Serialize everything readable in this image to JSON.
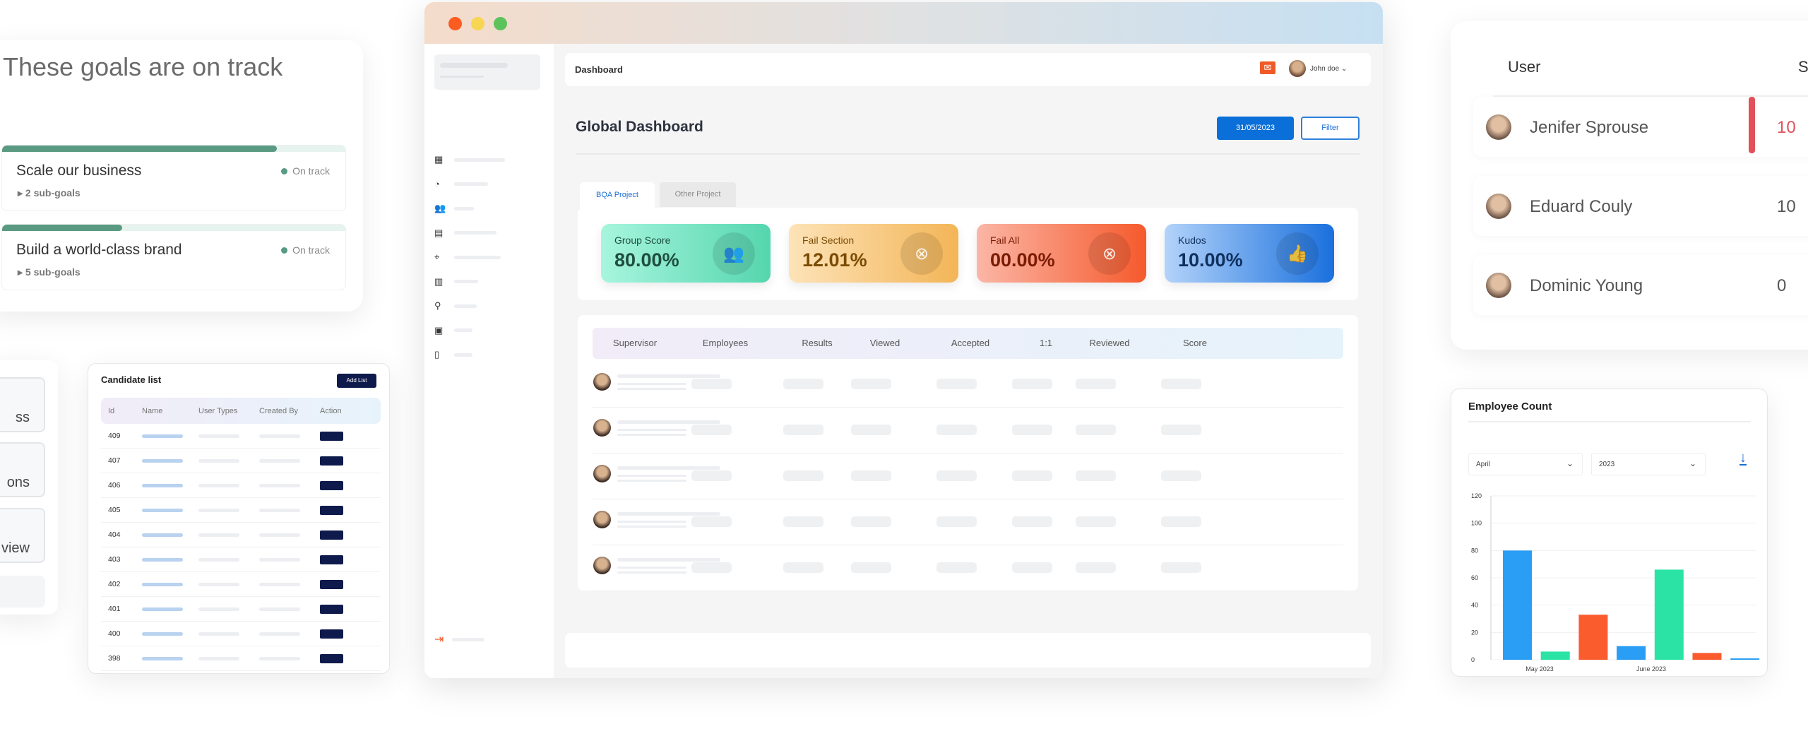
{
  "goals": {
    "title": "These goals are on track",
    "items": [
      {
        "name": "Scale our business",
        "subgoals": "2 sub-goals",
        "status": "On track",
        "progress": 0.8
      },
      {
        "name": "Build a world-class brand",
        "subgoals": "5 sub-goals",
        "status": "On track",
        "progress": 0.35
      }
    ]
  },
  "left_partial": {
    "items": [
      "ss",
      "ons",
      "view"
    ]
  },
  "candidates": {
    "title": "Candidate list",
    "add_button": "Add List",
    "columns": [
      "Id",
      "Name",
      "User Types",
      "Created By",
      "Action"
    ],
    "ids": [
      "409",
      "407",
      "406",
      "405",
      "404",
      "403",
      "402",
      "401",
      "400",
      "398"
    ]
  },
  "window": {
    "header": {
      "title": "Dashboard",
      "user": "John doe"
    },
    "page_title": "Global Dashboard",
    "date_button": "31/05/2023",
    "filter_button": "Filter",
    "tabs": [
      {
        "label": "BQA Project",
        "active": true
      },
      {
        "label": "Other Project",
        "active": false
      }
    ],
    "stats": [
      {
        "label": "Group Score",
        "value": "80.00%",
        "icon": "users-icon",
        "gradient": [
          "#a7f5dd",
          "#55d6ad"
        ],
        "color": "#1f4d3e"
      },
      {
        "label": "Fail Section",
        "value": "12.01%",
        "icon": "camera-x-icon",
        "gradient": [
          "#fde3b8",
          "#f3b557"
        ],
        "color": "#7a4c05"
      },
      {
        "label": "Fail All",
        "value": "00.00%",
        "icon": "camera-x-icon",
        "gradient": [
          "#fbb6a6",
          "#f55a2c"
        ],
        "color": "#7a1c04"
      },
      {
        "label": "Kudos",
        "value": "10.00%",
        "icon": "thumbs-up-icon",
        "gradient": [
          "#b3d3fa",
          "#1a70dd"
        ],
        "color": "#10305e"
      }
    ],
    "table": {
      "columns": [
        "Supervisor",
        "Employees",
        "Results",
        "Viewed",
        "Accepted",
        "1:1",
        "Reviewed",
        "Score"
      ],
      "row_count": 5
    }
  },
  "users": {
    "columns": [
      "User",
      "S"
    ],
    "rows": [
      {
        "name": "Jenifer Sprouse",
        "score": "10",
        "highlight": true
      },
      {
        "name": "Eduard Couly",
        "score": "10",
        "highlight": false
      },
      {
        "name": "Dominic Young",
        "score": "0",
        "highlight": false
      }
    ]
  },
  "chart_data": {
    "type": "bar",
    "title": "Employee Count",
    "month_select": "April",
    "year_select": "2023",
    "ylim": [
      0,
      120
    ],
    "yticks": [
      0,
      20,
      40,
      60,
      80,
      100,
      120
    ],
    "xtick_labels": [
      "May 2023",
      "June 2023"
    ],
    "values": [
      80,
      6,
      33,
      10,
      66,
      5,
      1
    ],
    "colors": [
      "#2a9df4",
      "#2ae3a5",
      "#fb5c2e",
      "#2a9df4",
      "#2ae3a5",
      "#fb5c2e",
      "#2a9df4"
    ],
    "grid": true
  }
}
